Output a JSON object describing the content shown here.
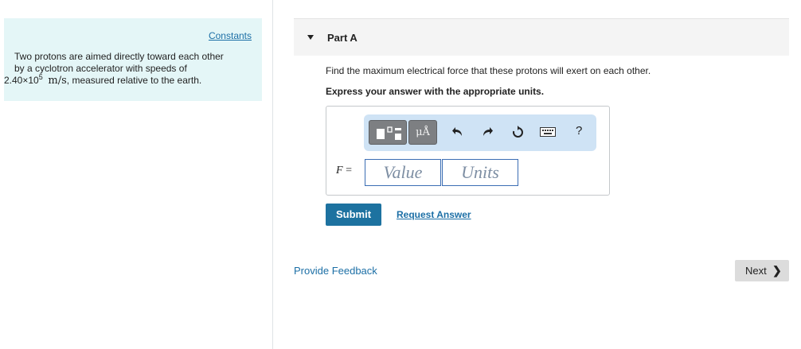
{
  "sidebar": {
    "constants_link": "Constants",
    "problem_line1": "Two protons are aimed directly toward each other",
    "problem_line2": "by a cyclotron accelerator with speeds of",
    "speed_mantissa": "2.40×10",
    "speed_exponent": "5",
    "speed_unit": "m/s",
    "speed_suffix": ", measured relative to the earth."
  },
  "part": {
    "title": "Part A",
    "question": "Find the maximum electrical force that these protons will exert on each other.",
    "instruction": "Express your answer with the appropriate units."
  },
  "toolbar": {
    "units_label": "μÅ",
    "icons": [
      "templates-icon",
      "units-icon",
      "undo-icon",
      "redo-icon",
      "reset-icon",
      "keyboard-icon",
      "help-icon"
    ],
    "help_label": "?"
  },
  "answer": {
    "variable": "F",
    "equals": "=",
    "value_placeholder": "Value",
    "units_placeholder": "Units"
  },
  "actions": {
    "submit_label": "Submit",
    "request_answer_label": "Request Answer",
    "feedback_label": "Provide Feedback",
    "next_label": "Next"
  },
  "colors": {
    "info_bg": "#e4f6f7",
    "link": "#1c6fa6",
    "submit_bg": "#1d72a0",
    "toolbar_bg": "#cfe3f5",
    "field_border": "#3b6db4"
  }
}
